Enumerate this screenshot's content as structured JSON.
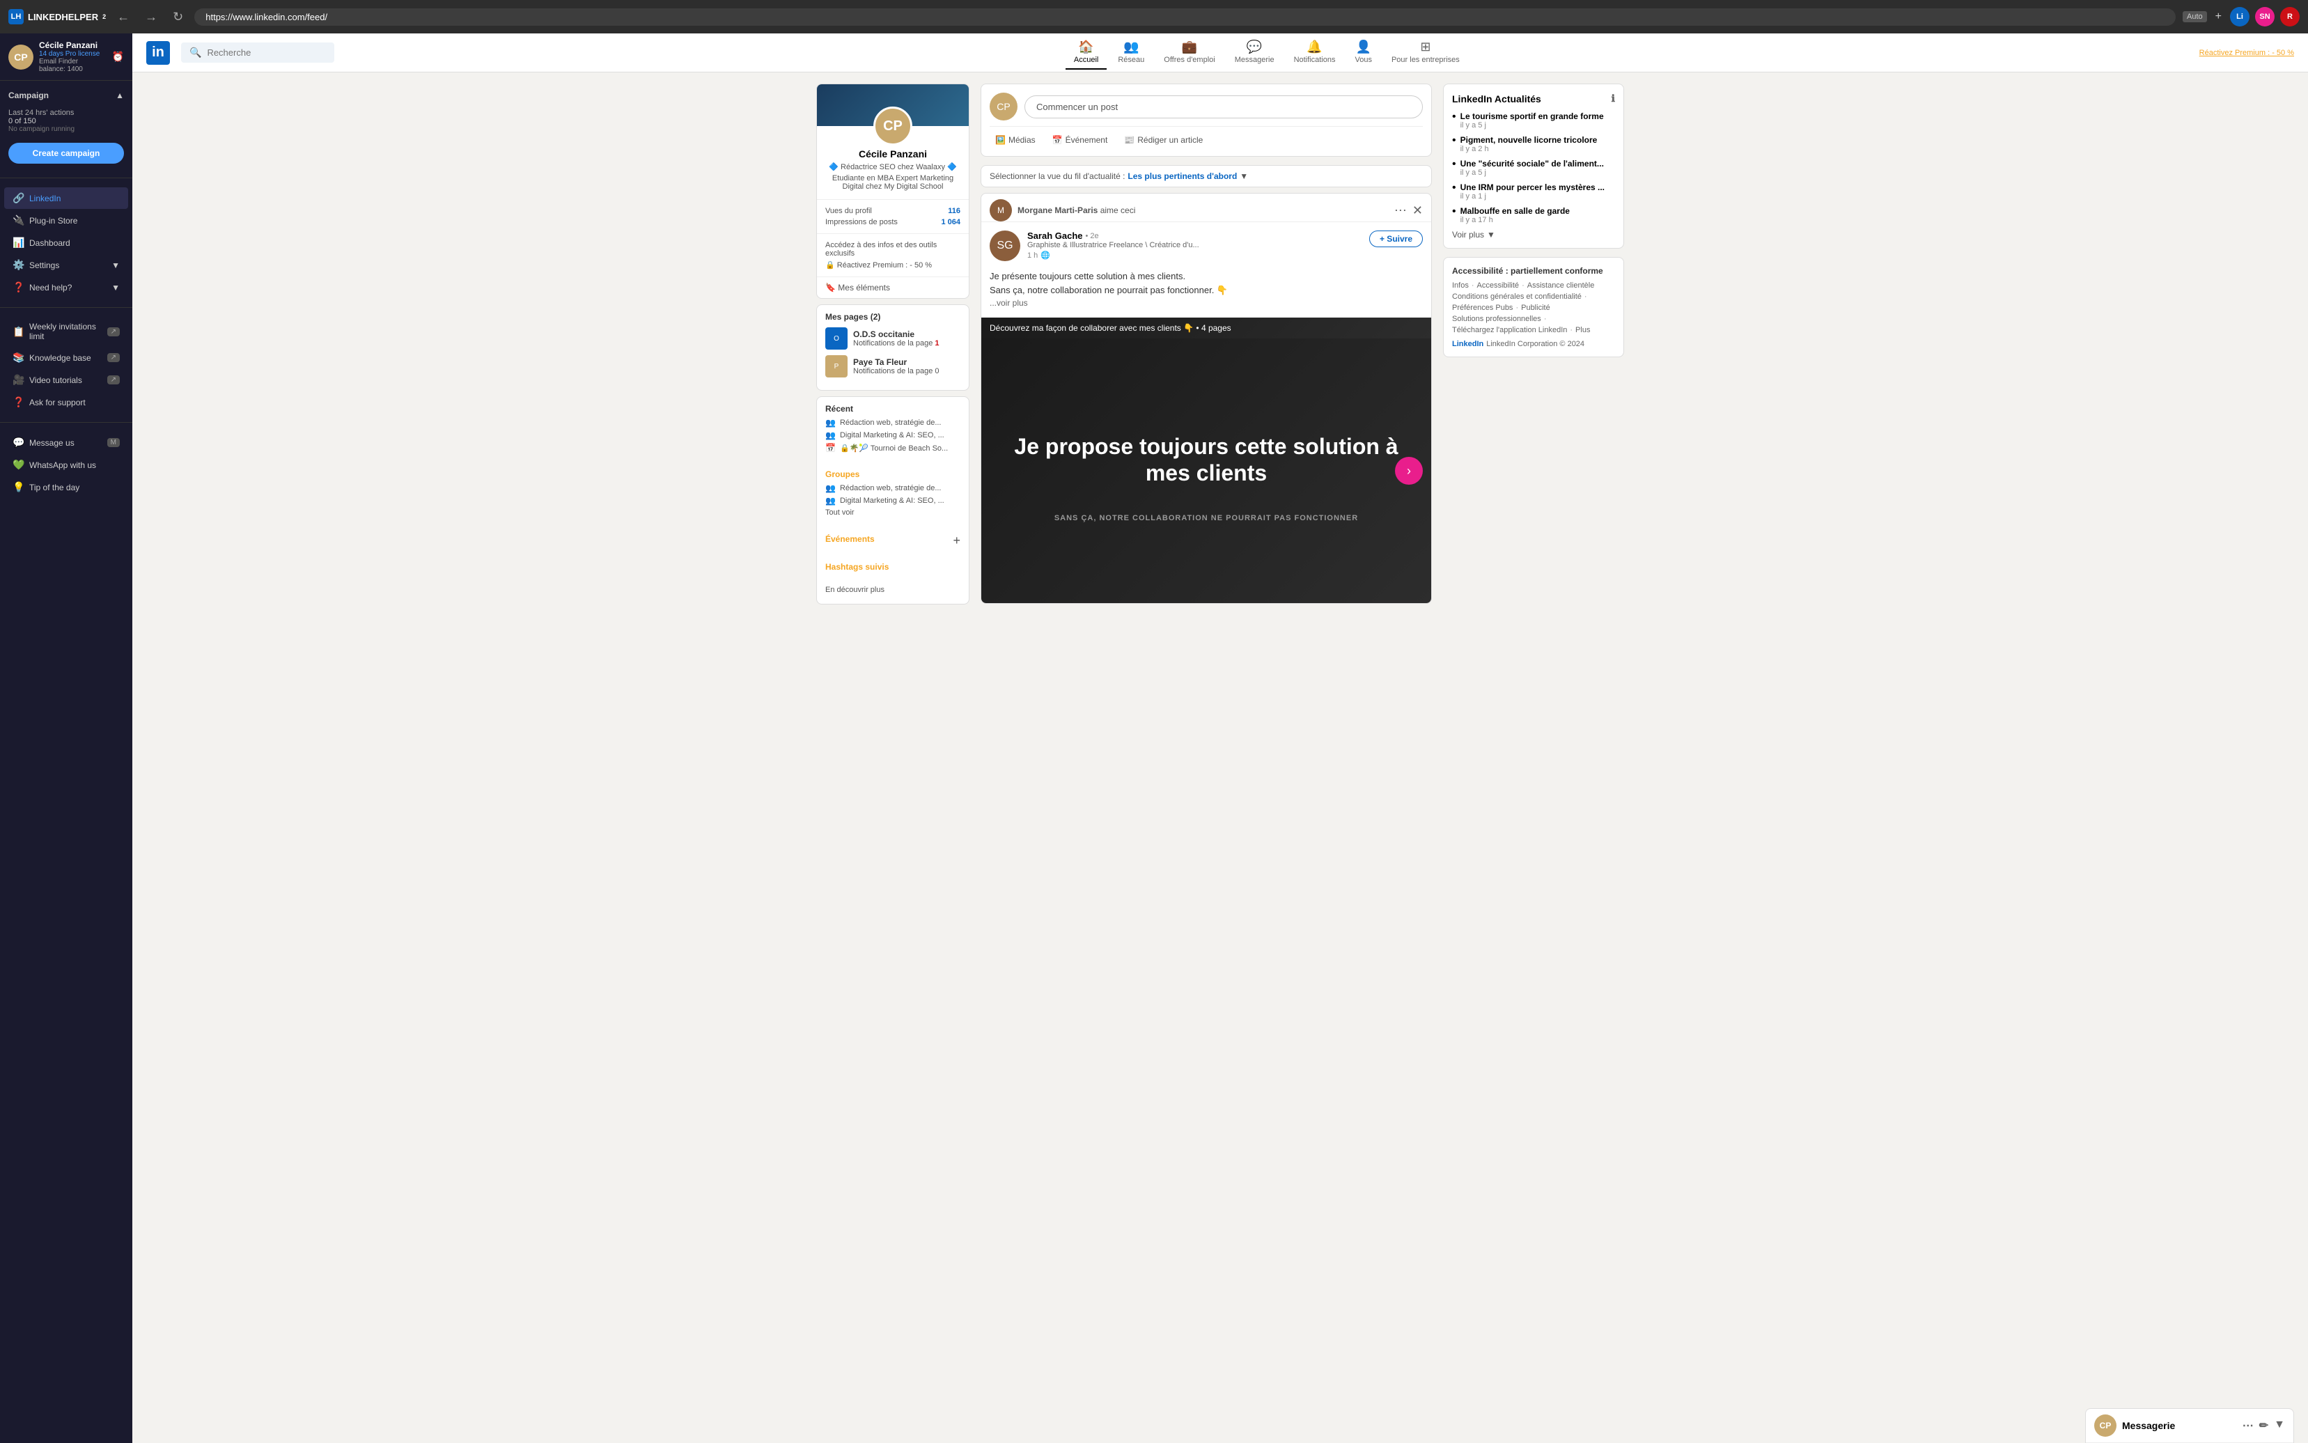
{
  "browser": {
    "url": "https://www.linkedin.com/feed/",
    "nav_back": "←",
    "nav_forward": "→",
    "nav_refresh": "↻",
    "auto_label": "Auto",
    "plus_label": "+",
    "avatars": [
      {
        "label": "Li",
        "color": "#0a66c2"
      },
      {
        "label": "SN",
        "color": "#e91e8c"
      },
      {
        "label": "R",
        "color": "#cc1016"
      }
    ]
  },
  "sidebar": {
    "logo_text": "LINKEDHELPER",
    "superscript": "2",
    "user": {
      "name": "Cécile Panzani",
      "license": "14 days Pro license",
      "email": "Email Finder balance: 1400"
    },
    "campaign_label": "Campaign",
    "last24_label": "Last 24 hrs' actions",
    "last24_value": "0 of 150",
    "no_campaign": "No campaign running",
    "create_btn": "Create campaign",
    "menu_items": [
      {
        "icon": "🔗",
        "label": "LinkedIn",
        "active": true
      },
      {
        "icon": "🔌",
        "label": "Plug-in Store"
      },
      {
        "icon": "📊",
        "label": "Dashboard"
      },
      {
        "icon": "⚙️",
        "label": "Settings"
      },
      {
        "icon": "❓",
        "label": "Need help?"
      }
    ],
    "help_items": [
      {
        "icon": "📋",
        "label": "Weekly invitations limit",
        "badge": "↗"
      },
      {
        "icon": "📚",
        "label": "Knowledge base",
        "badge": "↗"
      },
      {
        "icon": "🎥",
        "label": "Video tutorials",
        "badge": "↗"
      },
      {
        "icon": "❓",
        "label": "Ask for support"
      }
    ],
    "bottom_items": [
      {
        "icon": "💬",
        "label": "Message us",
        "badge": "M"
      },
      {
        "icon": "💚",
        "label": "WhatsApp with us"
      },
      {
        "icon": "💡",
        "label": "Tip of the day"
      }
    ]
  },
  "linkedin": {
    "topnav": {
      "search_placeholder": "Recherche",
      "nav_items": [
        {
          "icon": "🏠",
          "label": "Accueil",
          "active": true
        },
        {
          "icon": "👥",
          "label": "Réseau"
        },
        {
          "icon": "💼",
          "label": "Offres d'emploi"
        },
        {
          "icon": "💬",
          "label": "Messagerie"
        },
        {
          "icon": "🔔",
          "label": "Notifications"
        },
        {
          "icon": "👤",
          "label": "Vous"
        }
      ],
      "enterprise": "Pour les entreprises",
      "premium": "Réactivez Premium : - 50 %"
    },
    "left": {
      "profile": {
        "name": "Cécile Panzani",
        "title1": "🔷 Rédactrice SEO chez Waalaxy 🔷",
        "title2": "Etudiante en MBA Expert Marketing Digital chez My Digital School",
        "views_label": "Vues du profil",
        "views_value": "116",
        "impressions_label": "Impressions de posts",
        "impressions_value": "1 064",
        "exclusive_text": "Accédez à des infos et des outils exclusifs",
        "premium_text": "🔒 Réactivez Premium : - 50 %",
        "mes_elements": "🔖 Mes éléments"
      },
      "pages": {
        "title": "Mes pages (2)",
        "items": [
          {
            "name": "O.D.S occitanie",
            "notif_text": "Notifications de la page",
            "notif_count": "1"
          },
          {
            "name": "Paye Ta Fleur",
            "notif_text": "Notifications de la page",
            "notif_count": "0"
          }
        ]
      },
      "recent": {
        "title": "Récent",
        "items": [
          "Rédaction web, stratégie de...",
          "Digital Marketing & AI: SEO, ...",
          "🔒🌴🎾 Tournoi de Beach So..."
        ]
      },
      "groupes": {
        "title": "Groupes",
        "items": [
          "Rédaction web, stratégie de...",
          "Digital Marketing & AI: SEO, ..."
        ],
        "tout_voir": "Tout voir"
      },
      "evenements": {
        "title": "Événements"
      },
      "hashtags": {
        "title": "Hashtags suivis"
      },
      "en_decouvrir": "En découvrir plus"
    },
    "center": {
      "post_placeholder": "Commencer un post",
      "post_actions": [
        {
          "icon": "🖼️",
          "label": "Médias"
        },
        {
          "icon": "📅",
          "label": "Événement"
        },
        {
          "icon": "📰",
          "label": "Rédiger un article"
        }
      ],
      "feed_selector": "Sélectionner la vue du fil d'actualité :",
      "feed_option": "Les plus pertinents d'abord",
      "post": {
        "sharer": "Morgane Marti-Paris",
        "sharer_action": "aime ceci",
        "author": "Sarah Gache",
        "author_degree": "• 2e",
        "author_title": "Graphiste & Illustratrice Freelance \\ Créatrice d'u...",
        "post_time": "1 h",
        "post_text1": "Je présente toujours cette solution à mes clients.",
        "post_text2": "Sans ça, notre collaboration ne pourrait pas fonctionner. 👇",
        "post_more": "...voir plus",
        "banner_text": "Découvrez ma façon de collaborer avec mes clients 👇 • 4 pages",
        "image_text": "Je propose toujours cette solution à mes clients",
        "image_sub": "SANS ÇA, NOTRE COLLABORATION NE POURRAIT PAS FONCTIONNER",
        "follow_label": "+ Suivre"
      }
    },
    "right": {
      "news": {
        "title": "LinkedIn Actualités",
        "items": [
          {
            "headline": "Le tourisme sportif en grande forme",
            "time": "il y a 5 j"
          },
          {
            "headline": "Pigment, nouvelle licorne tricolore",
            "time": "il y a 2 h"
          },
          {
            "headline": "Une \"sécurité sociale\" de l'aliment...",
            "time": "il y a 5 j"
          },
          {
            "headline": "Une IRM pour percer les mystères ...",
            "time": "il y a 1 j"
          },
          {
            "headline": "Malbouffe en salle de garde",
            "time": "il y a 17 h"
          }
        ],
        "show_more": "Voir plus"
      },
      "accessibility": {
        "title": "Accessibilité : partiellement conforme",
        "links": [
          "Infos",
          "Accessibilité",
          "Assistance clientèle",
          "Conditions générales et confidentialité",
          "Préférences Pubs",
          "Publicité",
          "Solutions professionnelles",
          "Téléchargez l'application LinkedIn",
          "Plus"
        ]
      },
      "footer": "LinkedIn Corporation © 2024"
    },
    "messagerie": {
      "label": "Messagerie"
    }
  }
}
